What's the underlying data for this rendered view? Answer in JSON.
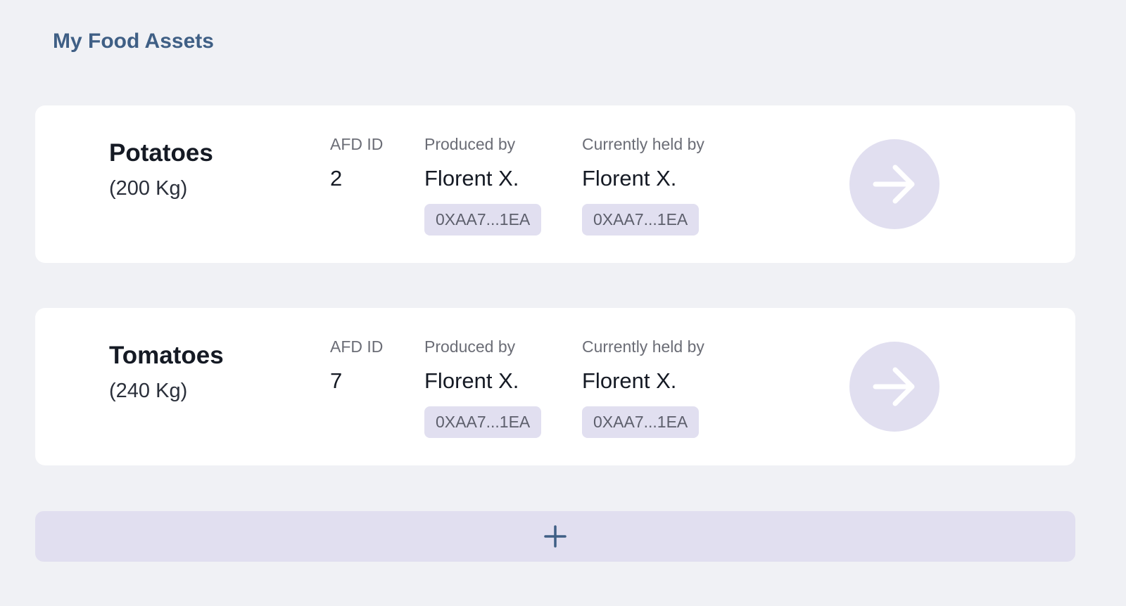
{
  "header": {
    "title": "My Food Assets"
  },
  "assets": [
    {
      "name": "Potatoes",
      "quantity": "(200 Kg)",
      "afd_label": "AFD ID",
      "afd_id": "2",
      "produced_label": "Produced by",
      "produced_name": "Florent X.",
      "produced_address": "0XAA7...1EA",
      "held_label": "Currently held by",
      "held_name": "Florent X.",
      "held_address": "0XAA7...1EA",
      "open_icon": "arrow-right-icon"
    },
    {
      "name": "Tomatoes",
      "quantity": "(240 Kg)",
      "afd_label": "AFD ID",
      "afd_id": "7",
      "produced_label": "Produced by",
      "produced_name": "Florent X.",
      "produced_address": "0XAA7...1EA",
      "held_label": "Currently held by",
      "held_name": "Florent X.",
      "held_address": "0XAA7...1EA",
      "open_icon": "arrow-right-icon"
    }
  ],
  "add_button": {
    "icon": "plus-icon"
  },
  "colors": {
    "background": "#f0f1f5",
    "card": "#ffffff",
    "accent_soft": "#e1dff0",
    "title": "#3f5f85"
  }
}
